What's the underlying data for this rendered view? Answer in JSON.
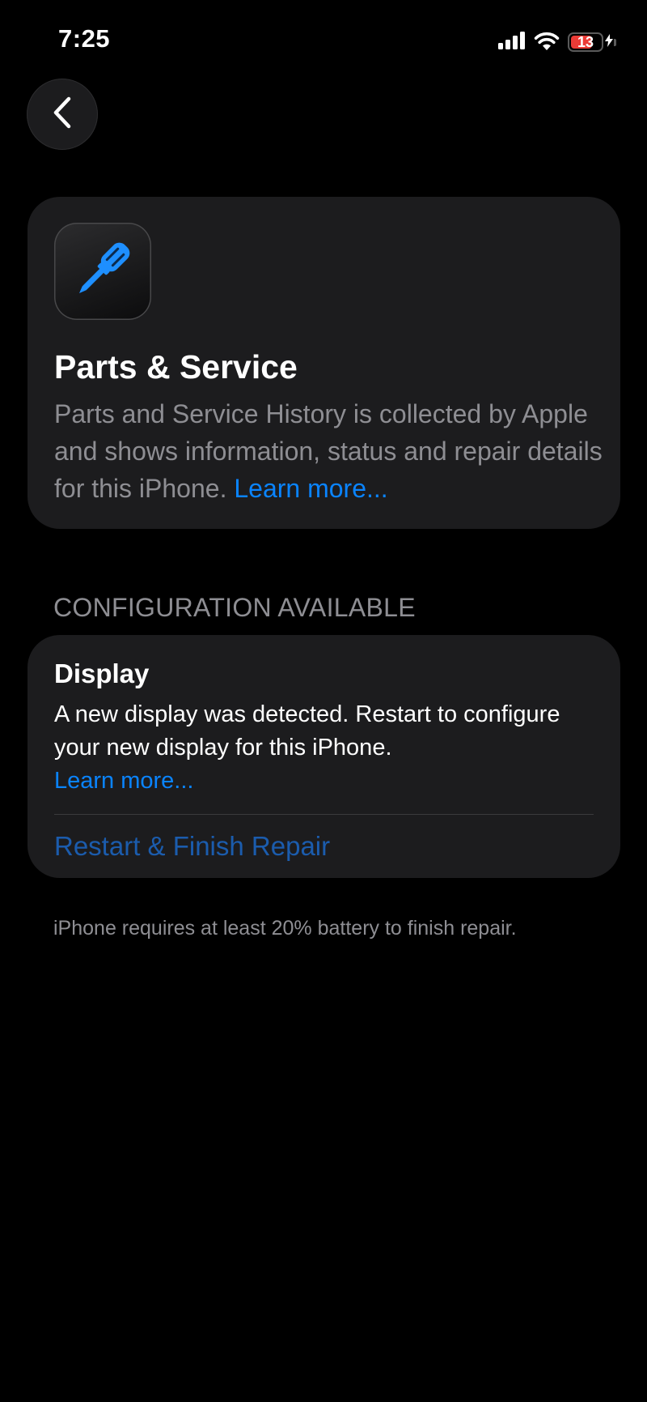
{
  "status_bar": {
    "time": "7:25",
    "battery_level": "13",
    "battery_fraction": 0.13,
    "battery_color": "#eb3b36",
    "icons": [
      "signal-icon",
      "wifi-icon",
      "battery-charging-icon"
    ]
  },
  "navigation": {
    "back_icon": "chevron-left-icon"
  },
  "parts_card": {
    "icon": "screwdriver-icon",
    "icon_color": "#1e8fff",
    "title": "Parts & Service",
    "description": "Parts and Service History is collected by Apple and shows information, status and repair details for this iPhone.",
    "learn_more": "Learn more..."
  },
  "configuration": {
    "section_header": "CONFIGURATION AVAILABLE",
    "title": "Display",
    "description": "A new display was detected. Restart to configure your new display for this iPhone.",
    "learn_more": "Learn more...",
    "action_label": "Restart & Finish Repair",
    "action_color": "#1b5cad"
  },
  "footer_note": "iPhone requires at least 20% battery to finish repair.",
  "colors": {
    "background": "#000000",
    "card": "#1c1c1e",
    "secondary_text": "#8e8e93",
    "link": "#0a84ff"
  }
}
